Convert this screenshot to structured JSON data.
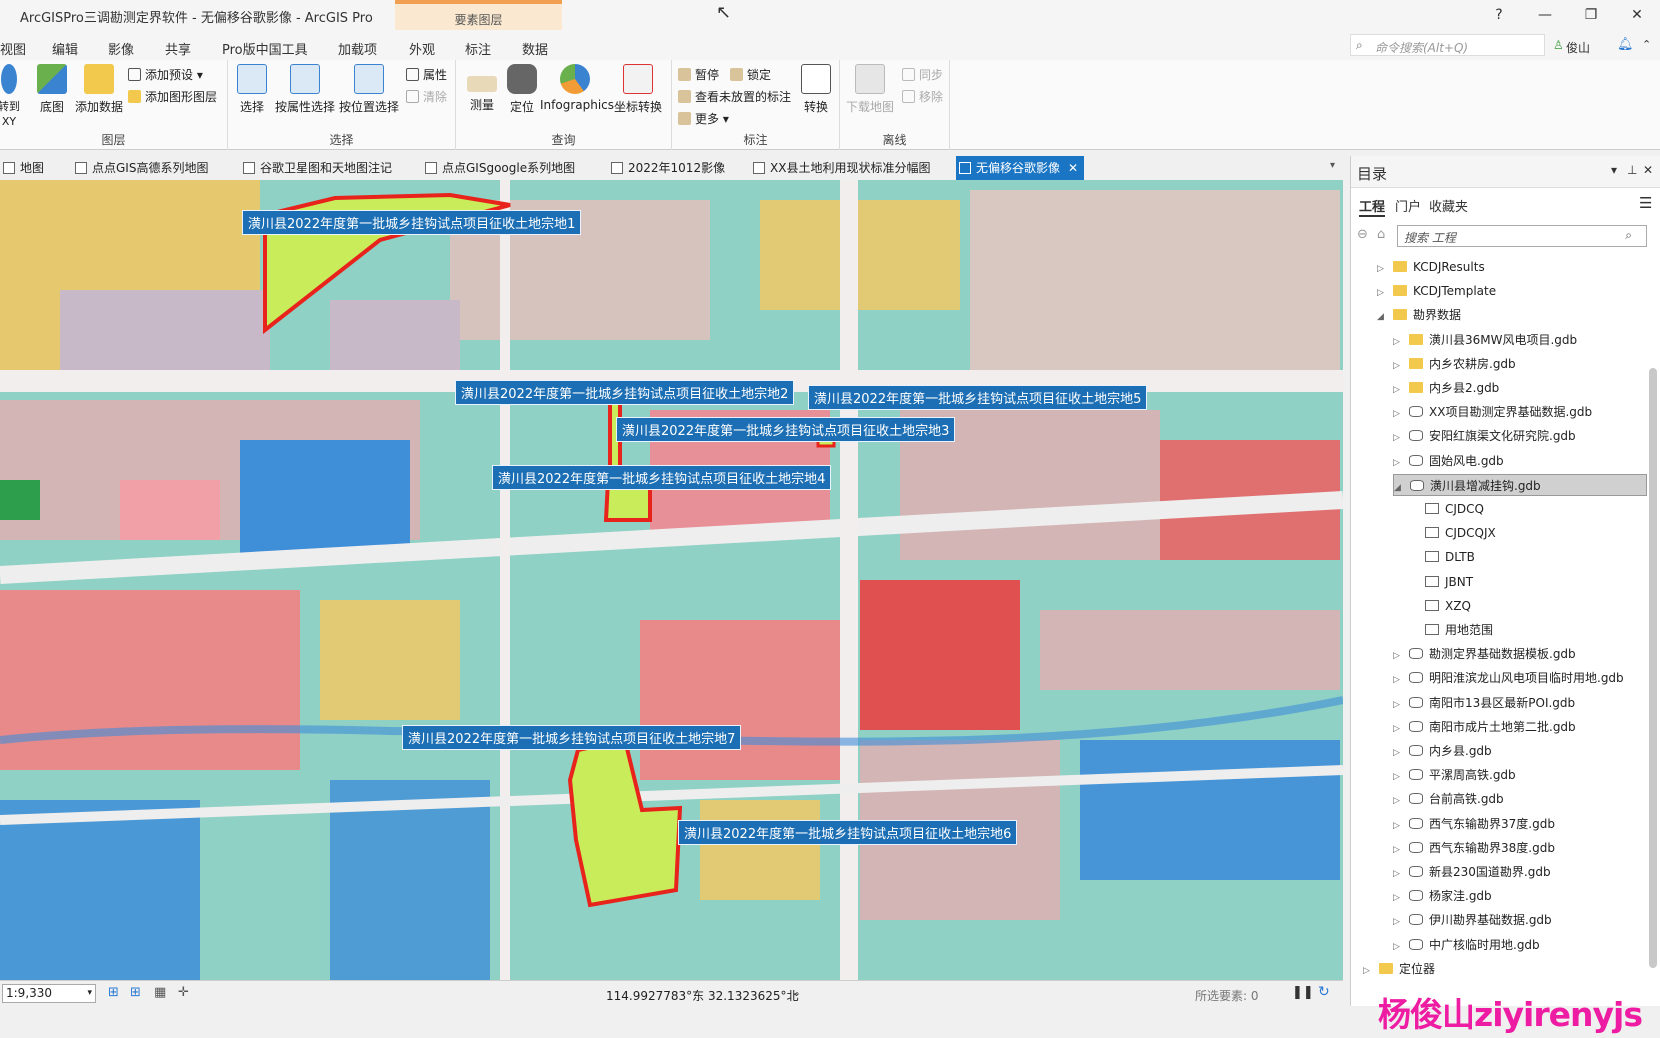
{
  "window": {
    "title": "ArcGISPro三调勘测定界软件 - 无偏移谷歌影像 - ArcGIS Pro",
    "context_tab_group": "要素图层",
    "controls": [
      "?",
      "—",
      "❐",
      "✕"
    ]
  },
  "ribbon_tabs": [
    "视图",
    "编辑",
    "影像",
    "共享",
    "Pro版中国工具",
    "加载项",
    "外观",
    "标注",
    "数据"
  ],
  "command_search": {
    "placeholder": "命令搜索(Alt+Q)"
  },
  "user": {
    "name": "俊山"
  },
  "ribbon": {
    "groups": [
      {
        "title": "图层",
        "buttons": [
          "底图",
          "添加数据"
        ],
        "small": [
          "添加预设",
          "添加图形图层"
        ],
        "partial": "转到 XY"
      },
      {
        "title": "选择",
        "buttons": [
          "选择",
          "按属性选择",
          "按位置选择"
        ],
        "small": [
          "属性",
          "清除"
        ]
      },
      {
        "title": "查询",
        "buttons": [
          "测量",
          "定位",
          "Infographics",
          "坐标转换"
        ]
      },
      {
        "title": "标注",
        "small": [
          "暂停",
          "锁定",
          "查看未放置的标注",
          "更多"
        ],
        "buttons": [
          "转换"
        ]
      },
      {
        "title": "离线",
        "buttons": [
          "下载地图"
        ],
        "small": [
          "同步",
          "移除"
        ]
      }
    ]
  },
  "doc_tabs": [
    {
      "label": "地图",
      "active": false
    },
    {
      "label": "点点GIS高德系列地图",
      "active": false
    },
    {
      "label": "谷歌卫星图和天地图注记",
      "active": false
    },
    {
      "label": "点点GISgoogle系列地图",
      "active": false
    },
    {
      "label": "2022年1012影像",
      "active": false
    },
    {
      "label": "XX县土地利用现状标准分幅图",
      "active": false
    },
    {
      "label": "无偏移谷歌影像",
      "active": true
    }
  ],
  "map": {
    "parcel_labels": [
      "潢川县2022年度第一批城乡挂钩试点项目征收土地宗地1",
      "潢川县2022年度第一批城乡挂钩试点项目征收土地宗地2",
      "潢川县2022年度第一批城乡挂钩试点项目征收土地宗地3",
      "潢川县2022年度第一批城乡挂钩试点项目征收土地宗地4",
      "潢川县2022年度第一批城乡挂钩试点项目征收土地宗地5",
      "潢川县2022年度第一批城乡挂钩试点项目征收土地宗地6",
      "潢川县2022年度第一批城乡挂钩试点项目征收土地宗地7"
    ],
    "parcel_outline_color": "#e8231c",
    "parcel_fill_color": "#c9ec5a"
  },
  "status": {
    "scale": "1:9,330",
    "coordinates": "114.9927783°东 32.1323625°北",
    "selected_features": "所选要素: 0"
  },
  "catalog": {
    "title": "目录",
    "tabs": [
      "工程",
      "门户",
      "收藏夹"
    ],
    "search_placeholder": "搜索 工程",
    "tree": [
      {
        "label": "KCDJResults",
        "type": "folder",
        "depth": 1,
        "expanded": false
      },
      {
        "label": "KCDJTemplate",
        "type": "folder",
        "depth": 1,
        "expanded": false
      },
      {
        "label": "勘界数据",
        "type": "folder",
        "depth": 1,
        "expanded": true
      },
      {
        "label": "潢川县36MW风电项目.gdb",
        "type": "folder",
        "depth": 2,
        "expanded": false
      },
      {
        "label": "内乡农耕房.gdb",
        "type": "folder",
        "depth": 2,
        "expanded": false
      },
      {
        "label": "内乡县2.gdb",
        "type": "folder",
        "depth": 2,
        "expanded": false
      },
      {
        "label": "XX项目勘测定界基础数据.gdb",
        "type": "gdb",
        "depth": 2,
        "expanded": false
      },
      {
        "label": "安阳红旗渠文化研究院.gdb",
        "type": "gdb",
        "depth": 2,
        "expanded": false
      },
      {
        "label": "固始风电.gdb",
        "type": "gdb",
        "depth": 2,
        "expanded": false
      },
      {
        "label": "潢川县增减挂钩.gdb",
        "type": "gdb",
        "depth": 2,
        "expanded": true,
        "selected": true
      },
      {
        "label": "CJDCQ",
        "type": "fc",
        "depth": 3
      },
      {
        "label": "CJDCQJX",
        "type": "fc",
        "depth": 3
      },
      {
        "label": "DLTB",
        "type": "fc",
        "depth": 3
      },
      {
        "label": "JBNT",
        "type": "fc",
        "depth": 3
      },
      {
        "label": "XZQ",
        "type": "fc",
        "depth": 3
      },
      {
        "label": "用地范围",
        "type": "fc",
        "depth": 3
      },
      {
        "label": "勘测定界基础数据模板.gdb",
        "type": "gdb",
        "depth": 2,
        "expanded": false
      },
      {
        "label": "明阳淮滨龙山风电项目临时用地.gdb",
        "type": "gdb",
        "depth": 2,
        "expanded": false
      },
      {
        "label": "南阳市13县区最新POI.gdb",
        "type": "gdb",
        "depth": 2,
        "expanded": false
      },
      {
        "label": "南阳市成片土地第二批.gdb",
        "type": "gdb",
        "depth": 2,
        "expanded": false
      },
      {
        "label": "内乡县.gdb",
        "type": "gdb",
        "depth": 2,
        "expanded": false
      },
      {
        "label": "平漯周高铁.gdb",
        "type": "gdb",
        "depth": 2,
        "expanded": false
      },
      {
        "label": "台前高铁.gdb",
        "type": "gdb",
        "depth": 2,
        "expanded": false
      },
      {
        "label": "西气东输勘界37度.gdb",
        "type": "gdb",
        "depth": 2,
        "expanded": false
      },
      {
        "label": "西气东输勘界38度.gdb",
        "type": "gdb",
        "depth": 2,
        "expanded": false
      },
      {
        "label": "新县230国道勘界.gdb",
        "type": "gdb",
        "depth": 2,
        "expanded": false
      },
      {
        "label": "杨家洼.gdb",
        "type": "gdb",
        "depth": 2,
        "expanded": false
      },
      {
        "label": "伊川勘界基础数据.gdb",
        "type": "gdb",
        "depth": 2,
        "expanded": false
      },
      {
        "label": "中广核临时用地.gdb",
        "type": "gdb",
        "depth": 2,
        "expanded": false
      },
      {
        "label": "定位器",
        "type": "folder",
        "depth": 0,
        "expanded": false
      }
    ]
  },
  "watermark": "杨俊山ziyirenyjs"
}
